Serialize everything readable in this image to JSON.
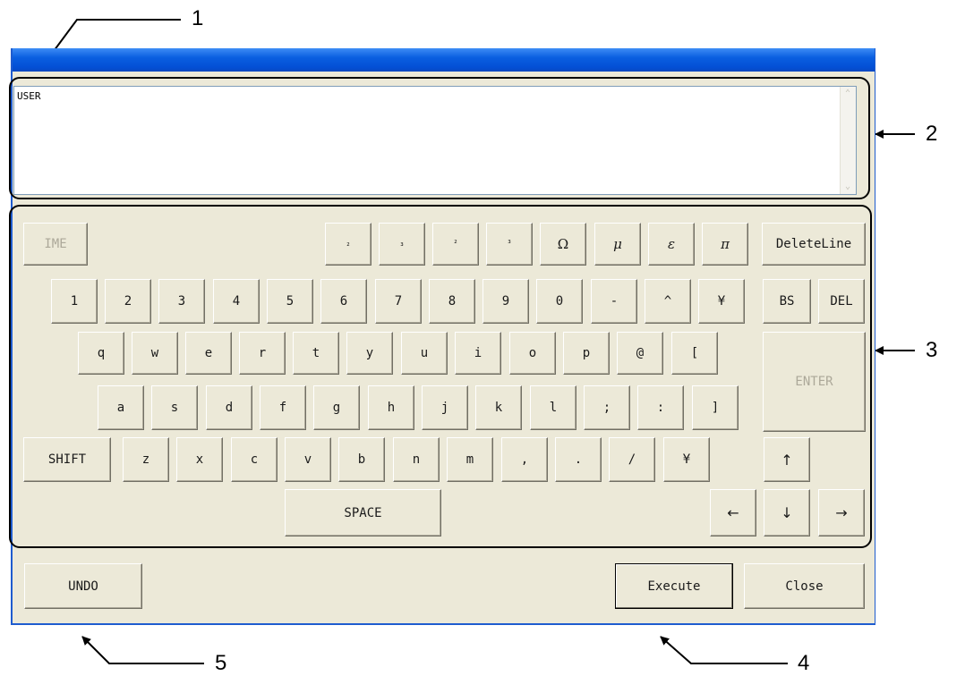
{
  "callouts": [
    "1",
    "2",
    "3",
    "4",
    "5"
  ],
  "text_area": {
    "value": "USER"
  },
  "icons": {
    "scroll_up": "chevron-up-icon",
    "scroll_down": "chevron-down-icon"
  },
  "colors": {
    "titlebar": "#0a5fe0",
    "window_bg": "#ece9d8",
    "frame": "#1f5ccf"
  },
  "keyboard": {
    "row0": [
      "IME",
      "₂",
      "₃",
      "²",
      "³",
      "Ω",
      "μ",
      "ε",
      "π",
      "DeleteLine"
    ],
    "row1": [
      "1",
      "2",
      "3",
      "4",
      "5",
      "6",
      "7",
      "8",
      "9",
      "0",
      "-",
      "^",
      "¥",
      "BS",
      "DEL"
    ],
    "row2": [
      "q",
      "w",
      "e",
      "r",
      "t",
      "y",
      "u",
      "i",
      "o",
      "p",
      "@",
      "["
    ],
    "enter": "ENTER",
    "row3": [
      "a",
      "s",
      "d",
      "f",
      "g",
      "h",
      "j",
      "k",
      "l",
      ";",
      ":",
      "]"
    ],
    "row4": [
      "SHIFT",
      "z",
      "x",
      "c",
      "v",
      "b",
      "n",
      "m",
      ",",
      ".",
      "/",
      "¥",
      "↑"
    ],
    "row5": [
      "SPACE",
      "←",
      "↓",
      "→"
    ]
  },
  "footer": {
    "undo": "UNDO",
    "execute": "Execute",
    "close": "Close"
  }
}
